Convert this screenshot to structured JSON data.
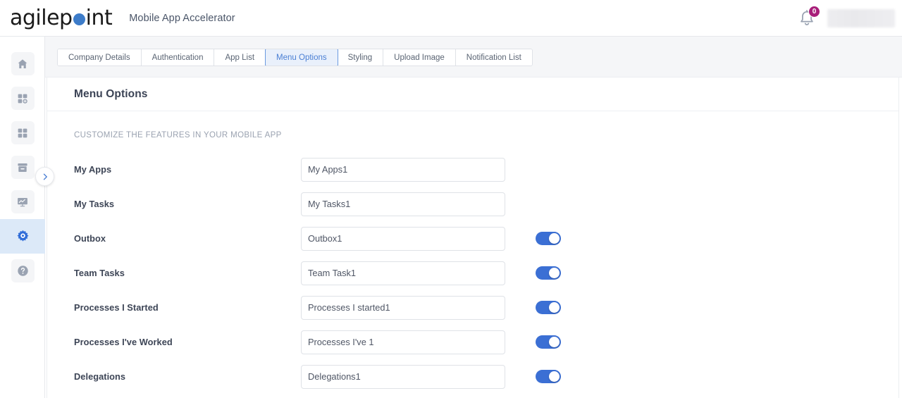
{
  "topbar": {
    "logo_part1": "agilep",
    "logo_dot_icon": "blue-dot",
    "logo_part2": "int",
    "app_title": "Mobile App Accelerator",
    "bell_icon": "bell-icon",
    "notification_count": "0",
    "user_name": ""
  },
  "sidebar": {
    "items": [
      {
        "icon": "home-icon",
        "label": "Home",
        "active": false
      },
      {
        "icon": "add-app-icon",
        "label": "Add App",
        "active": false
      },
      {
        "icon": "apps-grid-icon",
        "label": "Apps",
        "active": false
      },
      {
        "icon": "archive-icon",
        "label": "Archive",
        "active": false
      },
      {
        "icon": "analytics-icon",
        "label": "Analytics",
        "active": false
      },
      {
        "icon": "gear-icon",
        "label": "Settings",
        "active": true
      },
      {
        "icon": "help-icon",
        "label": "Help",
        "active": false
      }
    ],
    "expander_icon": "chevron-right-icon"
  },
  "tabs": [
    {
      "label": "Company Details",
      "active": false
    },
    {
      "label": "Authentication",
      "active": false
    },
    {
      "label": "App List",
      "active": false
    },
    {
      "label": "Menu Options",
      "active": true
    },
    {
      "label": "Styling",
      "active": false
    },
    {
      "label": "Upload Image",
      "active": false
    },
    {
      "label": "Notification List",
      "active": false
    }
  ],
  "main": {
    "title": "Menu Options",
    "caption": "CUSTOMIZE THE FEATURES IN YOUR MOBILE APP",
    "rows": [
      {
        "label": "My Apps",
        "value": "My Apps1",
        "has_toggle": false,
        "toggle_on": false
      },
      {
        "label": "My Tasks",
        "value": "My Tasks1",
        "has_toggle": false,
        "toggle_on": false
      },
      {
        "label": "Outbox",
        "value": "Outbox1",
        "has_toggle": true,
        "toggle_on": true
      },
      {
        "label": "Team Tasks",
        "value": "Team Task1",
        "has_toggle": true,
        "toggle_on": true
      },
      {
        "label": "Processes I Started",
        "value": "Processes I started1",
        "has_toggle": true,
        "toggle_on": true
      },
      {
        "label": "Processes I've Worked",
        "value": "Processes I've 1",
        "has_toggle": true,
        "toggle_on": true
      },
      {
        "label": "Delegations",
        "value": "Delegations1",
        "has_toggle": true,
        "toggle_on": true
      }
    ]
  },
  "colors": {
    "accent_blue": "#3b6fd4",
    "tab_active_text": "#4a7fd4",
    "tab_active_bg": "#e9f0fb",
    "badge_magenta": "#a81f7a",
    "sidebar_active_bg": "#dce9f8",
    "logo_dot": "#3d7cc9"
  }
}
